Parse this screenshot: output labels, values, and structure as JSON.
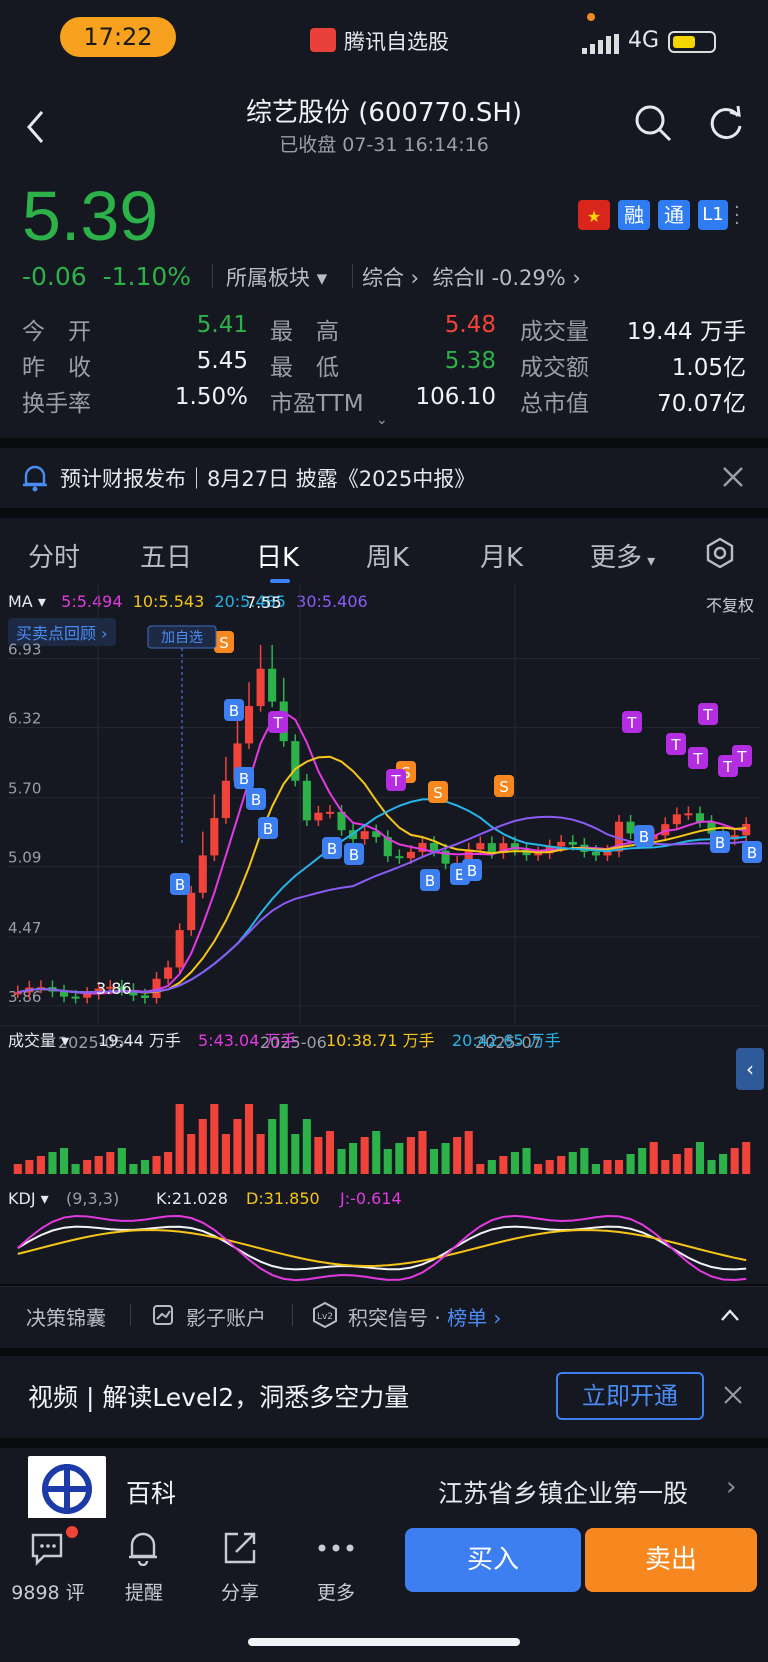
{
  "status_bar": {
    "time": "17:22",
    "app_name": "腾讯自选股",
    "network": "4G"
  },
  "header": {
    "title": "综艺股份 (600770.SH)",
    "subtitle": "已收盘   07-31 16:14:16"
  },
  "quote": {
    "price": "5.39",
    "change": "-0.06",
    "change_pct": "-1.10%",
    "sector_label": "所属板块",
    "sector_path": "综合",
    "sector_index": "综合Ⅱ -0.29%",
    "badges": [
      "融",
      "通",
      "L1"
    ],
    "stats": [
      {
        "label": "今　开",
        "value": "5.41",
        "color": "green"
      },
      {
        "label": "最　高",
        "value": "5.48",
        "color": "red"
      },
      {
        "label": "成交量",
        "value": "19.44 万手",
        "color": "white"
      },
      {
        "label": "昨　收",
        "value": "5.45",
        "color": "white"
      },
      {
        "label": "最　低",
        "value": "5.38",
        "color": "green"
      },
      {
        "label": "成交额",
        "value": "1.05亿",
        "color": "white"
      },
      {
        "label": "换手率",
        "value": "1.50%",
        "color": "white"
      },
      {
        "label": "市盈TTM",
        "value": "106.10",
        "color": "white"
      },
      {
        "label": "总市值",
        "value": "70.07亿",
        "color": "white"
      }
    ]
  },
  "notice": {
    "text": "预计财报发布｜8月27日 披露《2025中报》"
  },
  "tabs": [
    "分时",
    "五日",
    "日K",
    "周K",
    "月K",
    "更多"
  ],
  "active_tab": "日K",
  "ma_legend": {
    "label": "MA",
    "ma5": "5:5.494",
    "ma10": "10:5.543",
    "ma20": "20:5.485",
    "ma30": "30:5.406",
    "adjust": "不复权"
  },
  "buy_sell_review": "买卖点回顾",
  "add_watch_marker": "加自选",
  "chart_data": {
    "type": "candlestick",
    "y_ticks": [
      "6.93",
      "6.32",
      "5.70",
      "5.09",
      "4.47",
      "3.86"
    ],
    "x_ticks": [
      "2025-05",
      "2025-06",
      "2025-07"
    ],
    "high_label": "7.55",
    "low_label": "3.86",
    "colors": {
      "up": "#f0433a",
      "down": "#2db24a",
      "ma5": "#e23ae0",
      "ma10": "#f5c518",
      "ma20": "#26b3e8",
      "ma30": "#8a5cf5"
    },
    "volume_legend": {
      "label": "成交量",
      "vol": "19.44 万手",
      "ma5": "5:43.04 万手",
      "ma10": "10:38.71 万手",
      "ma20": "20:42.65 万手"
    },
    "kdj_legend": {
      "label": "KDJ",
      "params": "(9,3,3)",
      "k": "K:21.028",
      "d": "D:31.850",
      "j": "J:-0.614"
    }
  },
  "chart_footer": {
    "items": [
      "决策锦囊",
      "影子账户",
      "积突信号",
      "榜单"
    ]
  },
  "promo": {
    "text": "视频 | 解读Level2，洞悉多空力量",
    "button": "立即开通"
  },
  "baike": {
    "label": "百科",
    "text": "江苏省乡镇企业第一股"
  },
  "nav": {
    "comments": "9898 评",
    "remind": "提醒",
    "share": "分享",
    "more": "更多",
    "buy": "买入",
    "sell": "卖出"
  }
}
